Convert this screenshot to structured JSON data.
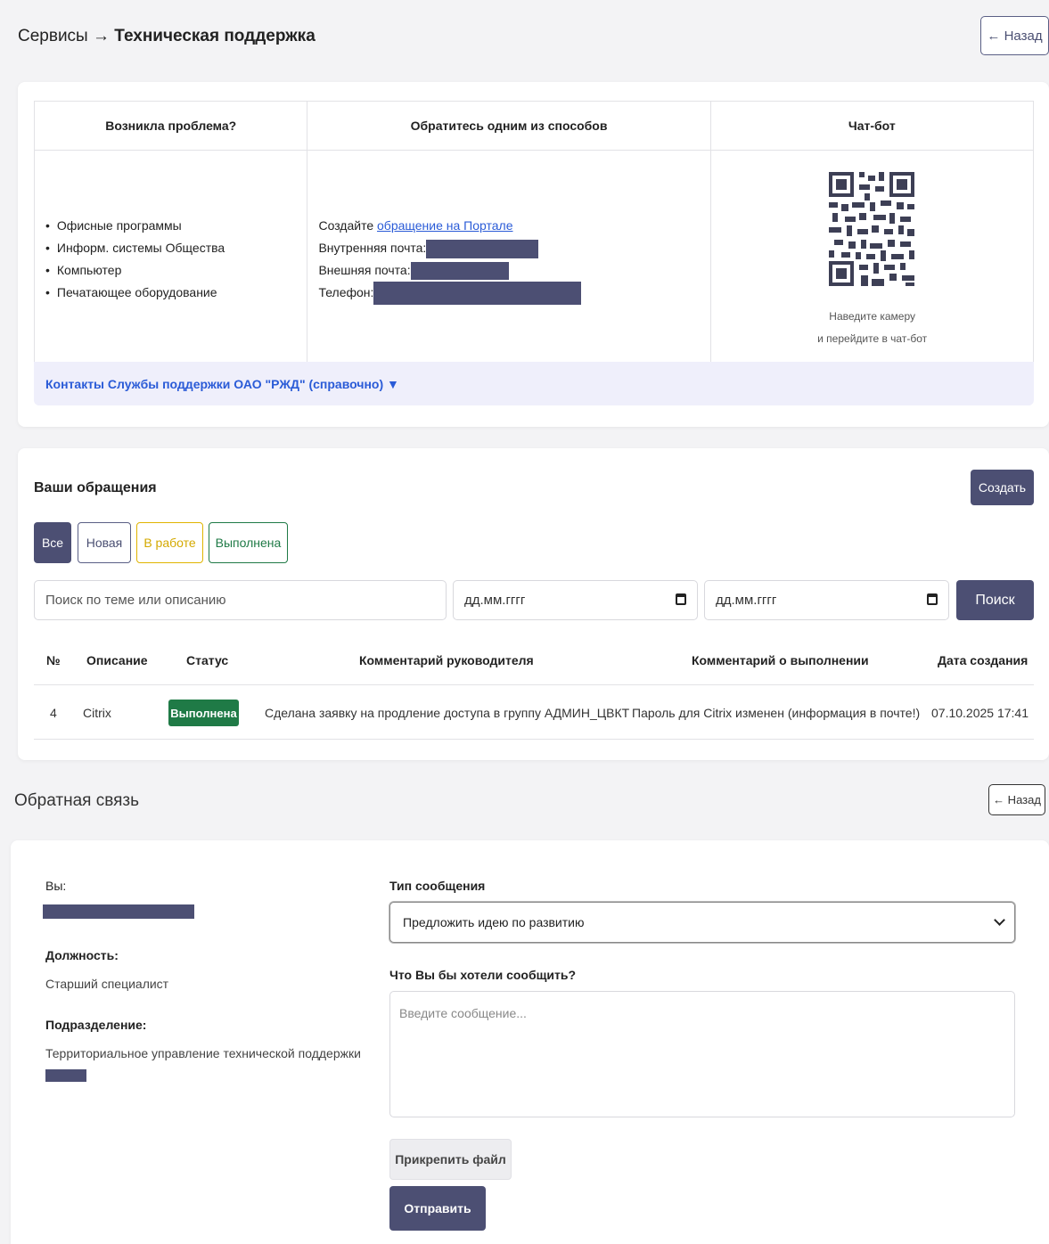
{
  "header": {
    "breadcrumb_parent": "Сервисы",
    "breadcrumb_sep": "→",
    "breadcrumb_current": "Техническая поддержка",
    "back_label": "← Назад"
  },
  "support": {
    "col1_title": "Возникла проблема?",
    "col2_title": "Обратитесь одним из способов",
    "col3_title": "Чат-бот",
    "problems": [
      "Офисные программы",
      "Информ. системы Общества",
      "Компьютер",
      "Печатающее оборудование"
    ],
    "ways": {
      "create_prefix": "Создайте ",
      "create_link": "обращение на Портале",
      "internal_mail": "Внутренняя почта:",
      "external_mail": "Внешняя почта:",
      "phone": "Телефон:"
    },
    "qr_caption_1": "Наведите камеру",
    "qr_caption_2": "и перейдите в чат-бот",
    "contacts_link": "Контакты Службы поддержки ОАО \"РЖД\" (справочно) ▼"
  },
  "requests": {
    "title": "Ваши обращения",
    "create_label": "Создать",
    "filters": [
      "Все",
      "Новая",
      "В работе",
      "Выполнена"
    ],
    "search_placeholder": "Поиск по теме или описанию",
    "date_from": "дд.мм.гггг",
    "date_to": "дд.мм.гггг",
    "search_label": "Поиск",
    "columns": [
      "№",
      "Описание",
      "Статус",
      "Комментарий руководителя",
      "Комментарий о выполнении",
      "Дата создания"
    ],
    "rows": [
      {
        "num": "4",
        "description": "Citrix",
        "status": "Выполнена",
        "manager_comment": "Сделана заявку на продление доступа в группу АДМИН_ЦВКТ",
        "completion_comment": "Пароль для Citrix изменен (информация в почте!)",
        "created": "07.10.2025 17:41"
      }
    ]
  },
  "feedback": {
    "title": "Обратная связь",
    "back_label": "← Назад",
    "you_label": "Вы:",
    "position_label": "Должность:",
    "position_value": "Старший специалист",
    "division_label": "Подразделение:",
    "division_value": "Территориальное управление технической поддержки",
    "type_label": "Тип сообщения",
    "type_value": "Предложить идею по развитию",
    "message_label": "Что Вы бы хотели сообщить?",
    "message_placeholder": "Введите сообщение...",
    "attach_label": "Прикрепить файл",
    "send_label": "Отправить"
  },
  "colors": {
    "accent": "#4c4f73",
    "link": "#2a5bd7",
    "success": "#1f7a46",
    "warning": "#e0b400",
    "redacted": "#4c4f73"
  },
  "icons": [
    "calendar-icon",
    "chevron-down-icon",
    "qr-code"
  ]
}
